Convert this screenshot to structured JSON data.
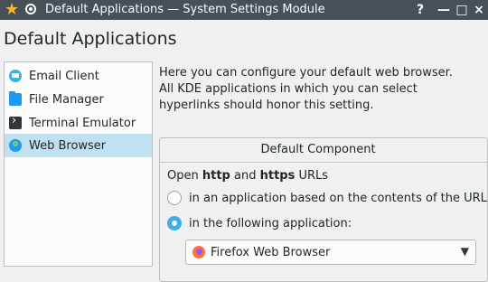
{
  "window": {
    "title": "Default Applications — System Settings Module",
    "buttons": {
      "help": "?",
      "minimize": "—",
      "maximize": "□",
      "close": "×"
    }
  },
  "page_title": "Default Applications",
  "sidebar": {
    "items": [
      {
        "label": "Email Client",
        "icon": "email-icon",
        "selected": false
      },
      {
        "label": "File Manager",
        "icon": "folder-icon",
        "selected": false
      },
      {
        "label": "Terminal Emulator",
        "icon": "terminal-icon",
        "selected": false
      },
      {
        "label": "Web Browser",
        "icon": "web-browser-icon",
        "selected": true
      }
    ]
  },
  "description": "Here you can configure your default web browser. All KDE applications in which you can select hyperlinks should honor this setting.",
  "group": {
    "title": "Default Component",
    "open_prefix": "Open ",
    "open_http": "http",
    "open_and": " and ",
    "open_https": "https",
    "open_suffix": " URLs",
    "option_url_based": "in an application based on the contents of the URL",
    "option_following": "in the following application:",
    "selected_option": "following"
  },
  "combo": {
    "value": "Firefox Web Browser",
    "icon": "firefox-icon"
  },
  "colors": {
    "titlebar": "#475057",
    "selection": "#bfe1f2",
    "accent": "#3daee9"
  }
}
